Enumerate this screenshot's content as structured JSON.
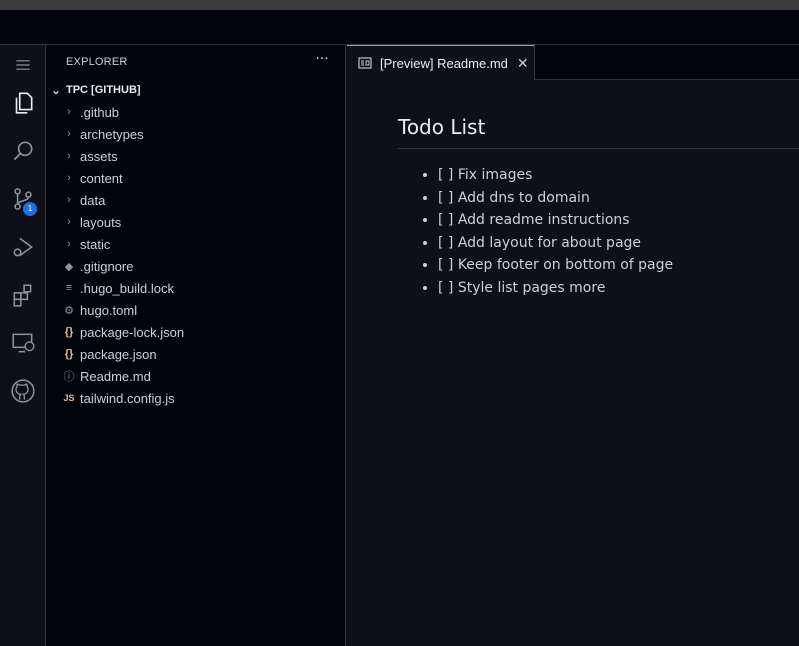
{
  "colors": {
    "accent_tab_border": "#f78166",
    "badge": "#1f6feb",
    "background": "#0d1117",
    "sidebar_background": "#010409",
    "json_icon": "#e2c08d"
  },
  "activity_bar": {
    "items": [
      {
        "name": "menu",
        "icon": "hamburger-menu-icon"
      },
      {
        "name": "explorer",
        "icon": "files-icon"
      },
      {
        "name": "search",
        "icon": "search-icon"
      },
      {
        "name": "source-control",
        "icon": "source-control-icon",
        "badge": "1"
      },
      {
        "name": "run-debug",
        "icon": "run-debug-icon"
      },
      {
        "name": "extensions",
        "icon": "extensions-icon"
      },
      {
        "name": "remote-explorer",
        "icon": "remote-explorer-icon"
      },
      {
        "name": "github",
        "icon": "github-icon"
      }
    ]
  },
  "sidebar": {
    "title": "EXPLORER",
    "more": "···",
    "root": "TPC [GITHUB]",
    "items": [
      {
        "label": ".github",
        "icon": "chevron-right-icon"
      },
      {
        "label": "archetypes",
        "icon": "chevron-right-icon"
      },
      {
        "label": "assets",
        "icon": "chevron-right-icon"
      },
      {
        "label": "content",
        "icon": "chevron-right-icon"
      },
      {
        "label": "data",
        "icon": "chevron-right-icon"
      },
      {
        "label": "layouts",
        "icon": "chevron-right-icon"
      },
      {
        "label": "static",
        "icon": "chevron-right-icon"
      },
      {
        "label": ".gitignore",
        "icon": "git-icon"
      },
      {
        "label": ".hugo_build.lock",
        "icon": "lines-icon"
      },
      {
        "label": "hugo.toml",
        "icon": "gear-icon"
      },
      {
        "label": "package-lock.json",
        "icon": "json-icon"
      },
      {
        "label": "package.json",
        "icon": "json-icon"
      },
      {
        "label": "Readme.md",
        "icon": "info-icon"
      },
      {
        "label": "tailwind.config.js",
        "icon": "js-icon"
      }
    ]
  },
  "editor": {
    "tab": {
      "label": "[Preview] Readme.md",
      "close": "✕"
    },
    "preview": {
      "heading": "Todo List",
      "items": [
        "[ ] Fix images",
        "[ ] Add dns to domain",
        "[ ] Add readme instructions",
        "[ ] Add layout for about page",
        "[ ] Keep footer on bottom of page",
        "[ ] Style list pages more"
      ]
    }
  }
}
